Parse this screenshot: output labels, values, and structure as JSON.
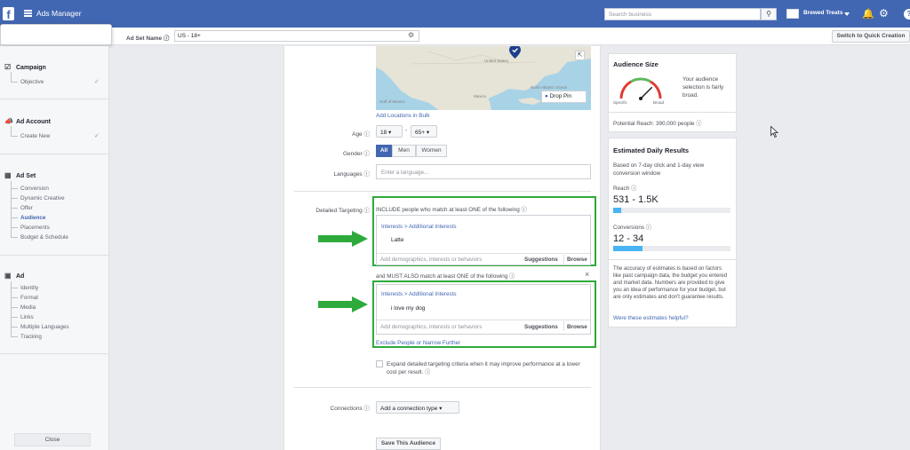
{
  "topbar": {
    "app_title": "Ads Manager",
    "search_placeholder": "Search business",
    "account_name": "Brewed Treats"
  },
  "subbar": {
    "ad_set_name_label": "Ad Set Name",
    "ad_set_name_value": "US - 18+",
    "quick_creation_label": "Switch to Quick Creation"
  },
  "sidebar": {
    "campaign": {
      "label": "Campaign",
      "items": [
        "Objective"
      ]
    },
    "ad_account": {
      "label": "Ad Account",
      "items": [
        "Create New"
      ]
    },
    "ad_set": {
      "label": "Ad Set",
      "items": [
        "Conversion",
        "Dynamic Creative",
        "Offer",
        "Audience",
        "Placements",
        "Budget & Schedule"
      ],
      "active": "Audience"
    },
    "ad": {
      "label": "Ad",
      "items": [
        "Identity",
        "Format",
        "Media",
        "Links",
        "Multiple Languages",
        "Tracking"
      ]
    },
    "close_label": "Close"
  },
  "map": {
    "drop_pin_label": "Drop Pin",
    "labels": [
      "United States",
      "Mexico",
      "Gulf of Mexico",
      "North Atlantic Ocean"
    ]
  },
  "audience": {
    "add_locations_bulk": "Add Locations in Bulk",
    "age_label": "Age",
    "age_min": "18",
    "age_max": "65+",
    "gender_label": "Gender",
    "gender_options": [
      "All",
      "Men",
      "Women"
    ],
    "gender_selected": "All",
    "languages_label": "Languages",
    "languages_placeholder": "Enter a language...",
    "detailed_targeting_label": "Detailed Targeting",
    "include_heading": "INCLUDE people who match at least ONE of the following",
    "group1": {
      "breadcrumb": "Interests > Additional Interests",
      "interest": "Latte"
    },
    "add_placeholder": "Add demographics, interests or behaviors",
    "suggestions_label": "Suggestions",
    "browse_label": "Browse",
    "must_also_heading": "and MUST ALSO match at least ONE of the following",
    "group2": {
      "breadcrumb": "Interests > Additional Interests",
      "interest": "i love my dog"
    },
    "exclude_link": "Exclude People or Narrow Further",
    "expand_text": "Expand detailed targeting criteria when it may improve performance at a lower cost per result.",
    "connections_label": "Connections",
    "connections_select": "Add a connection type",
    "save_audience_label": "Save This Audience"
  },
  "audience_size": {
    "title": "Audience Size",
    "description": "Your audience selection is fairly broad.",
    "specific_label": "Specific",
    "broad_label": "Broad",
    "potential_reach": "Potential Reach: 390,000 people",
    "gauge_level": 0.75
  },
  "daily_results": {
    "title": "Estimated Daily Results",
    "description": "Based on 7-day click and 1-day view conversion window",
    "reach_label": "Reach",
    "reach_value": "531 - 1.5K",
    "reach_fraction": 0.07,
    "conversions_label": "Conversions",
    "conversions_value": "12 - 34",
    "conversions_fraction": 0.25,
    "disclaimer": "The accuracy of estimates is based on factors like past campaign data, the budget you entered and market data. Numbers are provided to give you an idea of performance for your budget, but are only estimates and don't guarantee results.",
    "helpful_link": "Were these estimates helpful?"
  },
  "colors": {
    "brand": "#4267b2",
    "highlight": "#2eaa3c",
    "bar_fill": "#4ab3f4"
  }
}
